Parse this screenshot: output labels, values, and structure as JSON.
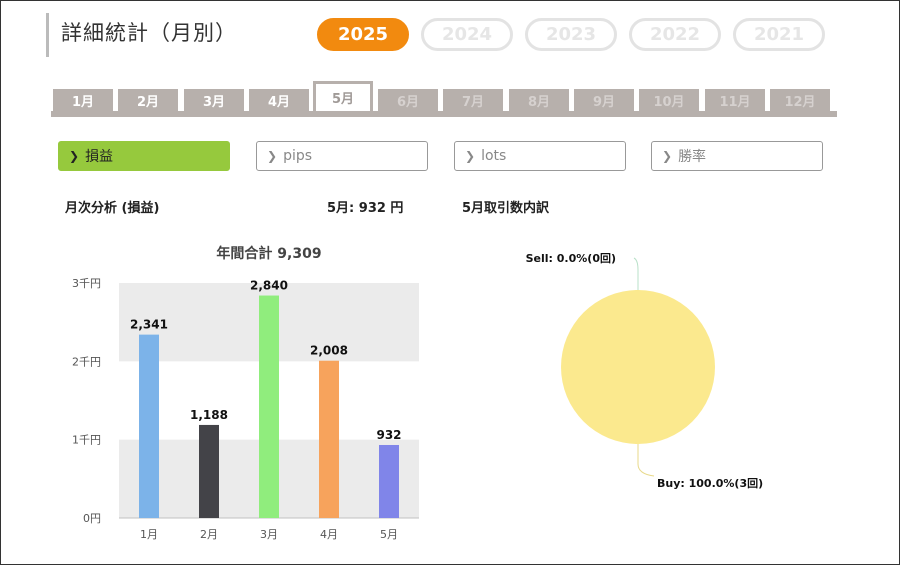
{
  "header": {
    "title": "詳細統計（月別）"
  },
  "years": [
    "2025",
    "2024",
    "2023",
    "2022",
    "2021"
  ],
  "months": [
    "1月",
    "2月",
    "3月",
    "4月",
    "5月",
    "6月",
    "7月",
    "8月",
    "9月",
    "10月",
    "11月",
    "12月"
  ],
  "metric_buttons": [
    "損益",
    "pips",
    "lots",
    "勝率"
  ],
  "section": {
    "left_title": "月次分析 (損益)",
    "current_value": "5月:  932 円",
    "right_title": "5月取引数内訳"
  },
  "chart_data": [
    {
      "type": "bar",
      "title": "年間合計 9,309",
      "categories": [
        "1月",
        "2月",
        "3月",
        "4月",
        "5月"
      ],
      "values": [
        2341,
        1188,
        2840,
        2008,
        932
      ],
      "value_labels": [
        "2,341",
        "1,188",
        "2,840",
        "2,008",
        "932"
      ],
      "bar_colors": [
        "#7cb3e9",
        "#434348",
        "#90ed7d",
        "#f7a35c",
        "#8085e9"
      ],
      "ylim": [
        0,
        3000
      ],
      "yticks": [
        0,
        1000,
        2000,
        3000
      ],
      "ytick_labels": [
        "0円",
        "1千円",
        "2千円",
        "3千円"
      ],
      "grid": "alternating bands"
    },
    {
      "type": "pie",
      "slices": [
        {
          "label": "Sell: 0.0%(0回)",
          "value": 0,
          "color": "#ffffff"
        },
        {
          "label": "Buy: 100.0%(3回)",
          "value": 100,
          "color": "#fbe98e"
        }
      ]
    }
  ]
}
